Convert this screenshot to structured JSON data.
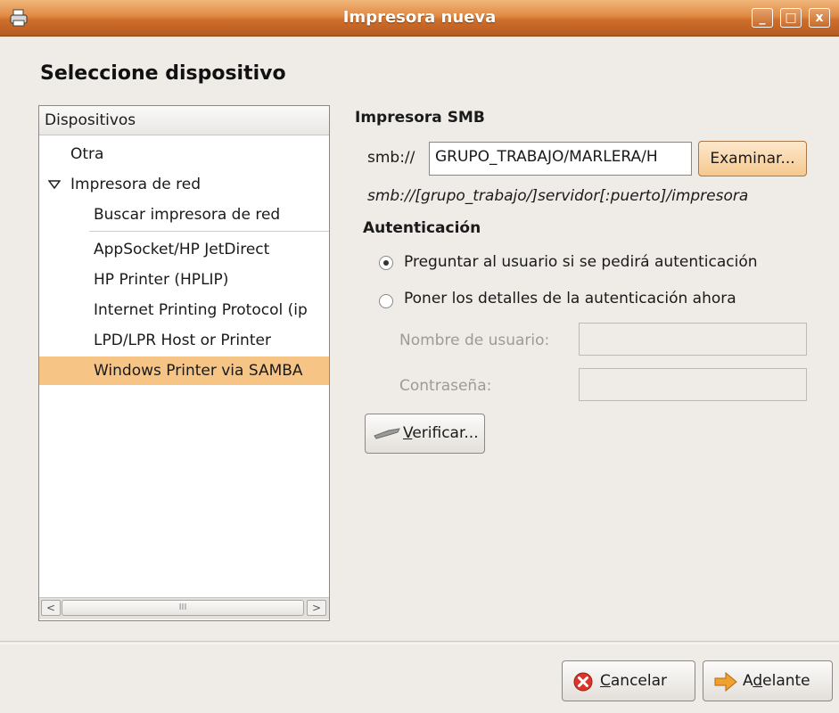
{
  "window": {
    "title": "Impresora nueva",
    "controls": {
      "minimize": "_",
      "maximize": "□",
      "close": "x"
    }
  },
  "heading": "Seleccione dispositivo",
  "devices": {
    "header": "Dispositivos",
    "items": [
      {
        "label": "Otra"
      },
      {
        "label": "Impresora de red",
        "expanded": true
      },
      {
        "label": "Buscar impresora de red"
      },
      {
        "label": "AppSocket/HP JetDirect"
      },
      {
        "label": "HP Printer (HPLIP)"
      },
      {
        "label": "Internet Printing Protocol (ip"
      },
      {
        "label": "LPD/LPR Host or Printer"
      },
      {
        "label": "Windows Printer via SAMBA",
        "selected": true
      }
    ],
    "scroll_thumb_mark": "III"
  },
  "smb": {
    "section_title": "Impresora SMB",
    "prefix": "smb://",
    "value": "GRUPO_TRABAJO/MARLERA/H",
    "browse_button": "Examinar...",
    "hint": "smb://[grupo_trabajo/]servidor[:puerto]/impresora"
  },
  "auth": {
    "section_title": "Autenticación",
    "option_ask": "Preguntar al usuario si se pedirá autenticación",
    "option_now": "Poner los detalles de la autenticación ahora",
    "selected": "ask",
    "username_label": "Nombre de usuario:",
    "username_value": "",
    "password_label": "Contraseña:",
    "password_value": "",
    "verify_prefix": "V",
    "verify_rest": "erificar..."
  },
  "footer": {
    "cancel_prefix": "C",
    "cancel_rest": "ancelar",
    "forward_prefix": "A",
    "forward_mnemonic": "d",
    "forward_rest": "elante"
  },
  "colors": {
    "titlebar": "#e08a45",
    "selection": "#f6c586",
    "cancel_icon": "#d9352b",
    "forward_icon": "#f0a030"
  }
}
